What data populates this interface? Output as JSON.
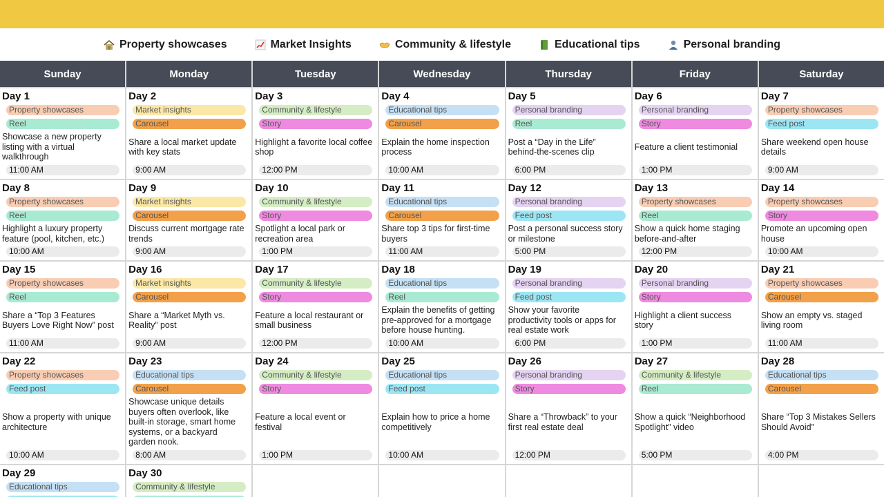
{
  "legend": [
    {
      "icon": "house-icon",
      "label": "Property showcases"
    },
    {
      "icon": "chart-icon",
      "label": "Market Insights"
    },
    {
      "icon": "handshake-icon",
      "label": "Community & lifestyle"
    },
    {
      "icon": "book-icon",
      "label": "Educational tips"
    },
    {
      "icon": "person-icon",
      "label": "Personal branding"
    }
  ],
  "days_of_week": [
    "Sunday",
    "Monday",
    "Tuesday",
    "Wednesday",
    "Thursday",
    "Friday",
    "Saturday"
  ],
  "colors": {
    "topbar": "#f0c842",
    "header": "#464b57",
    "category": {
      "Property showcases": "#f8cdb4",
      "Market insights": "#fbe8a6",
      "Community & lifestyle": "#d5edc4",
      "Educational tips": "#c5e0f4",
      "Personal branding": "#e5d3f2"
    },
    "format": {
      "Reel": "#a9ead2",
      "Carousel": "#f2a14a",
      "Story": "#ee8adf",
      "Feed post": "#9ce6f4"
    }
  },
  "days": [
    {
      "day": "Day 1",
      "category": "Property showcases",
      "format": "Reel",
      "description": "Showcase a new property listing with a virtual walkthrough",
      "time": "11:00 AM"
    },
    {
      "day": "Day 2",
      "category": "Market insights",
      "format": "Carousel",
      "description": "Share a local market update with key stats",
      "time": "9:00 AM"
    },
    {
      "day": "Day 3",
      "category": "Community & lifestyle",
      "format": "Story",
      "description": "Highlight a favorite local coffee shop",
      "time": "12:00 PM"
    },
    {
      "day": "Day 4",
      "category": "Educational tips",
      "format": "Carousel",
      "description": "Explain the home inspection process",
      "time": "10:00 AM"
    },
    {
      "day": "Day 5",
      "category": "Personal branding",
      "format": "Reel",
      "description": "Post a “Day in the Life” behind-the-scenes clip",
      "time": "6:00 PM"
    },
    {
      "day": "Day 6",
      "category": "Personal branding",
      "format": "Story",
      "description": "Feature a client testimonial",
      "time": "1:00 PM"
    },
    {
      "day": "Day 7",
      "category": "Property showcases",
      "format": "Feed post",
      "description": "Share weekend open house details",
      "time": "9:00 AM"
    },
    {
      "day": "Day 8",
      "category": "Property showcases",
      "format": "Reel",
      "description": "Highlight a luxury property feature (pool, kitchen, etc.)",
      "time": "10:00 AM"
    },
    {
      "day": "Day 9",
      "category": "Market insights",
      "format": "Carousel",
      "description": "Discuss current mortgage rate trends",
      "time": "9:00 AM"
    },
    {
      "day": "Day 10",
      "category": "Community & lifestyle",
      "format": "Story",
      "description": "Spotlight a local park or recreation area",
      "time": "1:00 PM"
    },
    {
      "day": "Day 11",
      "category": "Educational tips",
      "format": "Carousel",
      "description": "Share top 3 tips for first-time buyers",
      "time": "11:00 AM"
    },
    {
      "day": "Day 12",
      "category": "Personal branding",
      "format": "Feed post",
      "description": "Post a personal success story or milestone",
      "time": "5:00 PM"
    },
    {
      "day": "Day 13",
      "category": "Property showcases",
      "format": "Reel",
      "description": "Show a quick home staging before-and-after",
      "time": "12:00 PM"
    },
    {
      "day": "Day 14",
      "category": "Property showcases",
      "format": "Story",
      "description": "Promote an upcoming open house",
      "time": "10:00 AM"
    },
    {
      "day": "Day 15",
      "category": "Property showcases",
      "format": "Reel",
      "description": "Share a “Top 3 Features Buyers Love Right Now” post",
      "time": "11:00 AM"
    },
    {
      "day": "Day 16",
      "category": "Market insights",
      "format": "Carousel",
      "description": "Share a “Market Myth vs. Reality” post",
      "time": "9:00 AM"
    },
    {
      "day": "Day 17",
      "category": "Community & lifestyle",
      "format": "Story",
      "description": "Feature a local restaurant or small business",
      "time": "12:00 PM"
    },
    {
      "day": "Day 18",
      "category": "Educational tips",
      "format": "Reel",
      "description": "Explain the benefits of getting pre-approved for a mortgage before house hunting.",
      "time": "10:00 AM"
    },
    {
      "day": "Day 19",
      "category": "Personal branding",
      "format": "Feed post",
      "description": "Show your favorite productivity tools or apps for real estate work",
      "time": "6:00 PM"
    },
    {
      "day": "Day 20",
      "category": "Personal branding",
      "format": "Story",
      "description": "Highlight a client success story",
      "time": "1:00 PM"
    },
    {
      "day": "Day 21",
      "category": "Property showcases",
      "format": "Carousel",
      "description": "Show an empty vs. staged living room",
      "time": "11:00 AM"
    },
    {
      "day": "Day 22",
      "category": "Property showcases",
      "format": "Feed post",
      "description": "Show a property with unique architecture",
      "time": "10:00 AM"
    },
    {
      "day": "Day 23",
      "category": "Educational tips",
      "format": "Carousel",
      "description": "Showcase unique details buyers often overlook, like built-in storage, smart home systems, or a backyard garden nook.",
      "time": "8:00 AM"
    },
    {
      "day": "Day 24",
      "category": "Community & lifestyle",
      "format": "Story",
      "description": "Feature a local event or festival",
      "time": "1:00 PM"
    },
    {
      "day": "Day 25",
      "category": "Educational tips",
      "format": "Feed post",
      "description": "Explain how to price a home competitively",
      "time": "10:00 AM"
    },
    {
      "day": "Day 26",
      "category": "Personal branding",
      "format": "Story",
      "description": "Share a “Throwback” to your first real estate deal",
      "time": "12:00 PM"
    },
    {
      "day": "Day 27",
      "category": "Community & lifestyle",
      "format": "Reel",
      "description": "Show a quick “Neighborhood Spotlight” video",
      "time": "5:00 PM"
    },
    {
      "day": "Day 28",
      "category": "Educational tips",
      "format": "Carousel",
      "description": "Share “Top 3 Mistakes Sellers Should Avoid”",
      "time": "4:00 PM"
    },
    {
      "day": "Day 29",
      "category": "Educational tips",
      "format": "Feed post",
      "description": "",
      "time": ""
    },
    {
      "day": "Day 30",
      "category": "Community & lifestyle",
      "format": "Reel",
      "description": "",
      "time": ""
    }
  ]
}
